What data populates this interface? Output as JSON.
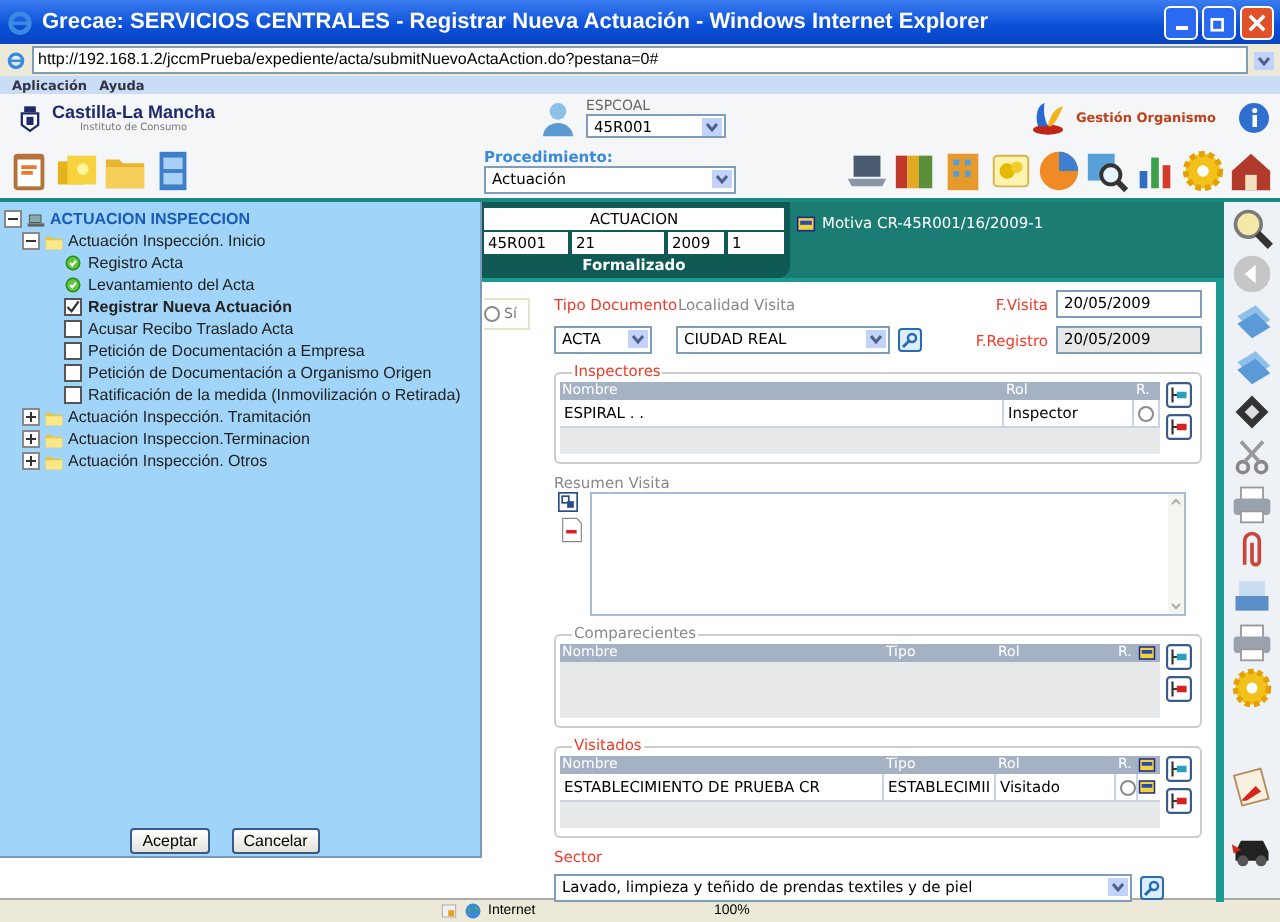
{
  "window": {
    "title": "Grecae: SERVICIOS CENTRALES - Registrar Nueva Actuación - Windows Internet Explorer"
  },
  "address_bar": {
    "url": "http://192.168.1.2/jccmPrueba/expediente/acta/submitNuevoActaAction.do?pestana=0#"
  },
  "menu": [
    "Aplicación",
    "Ayuda"
  ],
  "header": {
    "logo_title": "Castilla-La Mancha",
    "logo_subtitle": "Instituto de Consumo",
    "user": "ESPCOAL",
    "user_select": "45R001",
    "organismo": "Gestión Organismo"
  },
  "procedimiento": {
    "label": "Procedimiento:",
    "value": "Actuación"
  },
  "actuacion": {
    "title": "ACTUACION",
    "fields": [
      "45R001",
      "21",
      "2009",
      "1"
    ],
    "status": "Formalizado",
    "motiva": "Motiva CR-45R001/16/2009-1"
  },
  "si_option": {
    "label": "Sí",
    "checked": false
  },
  "form": {
    "tipo_documento": {
      "label": "Tipo Documento",
      "value": "ACTA"
    },
    "localidad": {
      "label": "Localidad Visita",
      "value": "CIUDAD REAL"
    },
    "f_visita": {
      "label": "F.Visita",
      "value": "20/05/2009"
    },
    "f_registro": {
      "label": "F.Registro",
      "value": "20/05/2009"
    },
    "inspectores": {
      "legend": "Inspectores",
      "columns": [
        "Nombre",
        "Rol",
        "R."
      ],
      "rows": [
        {
          "cells": [
            "ESPIRAL . .",
            "Inspector"
          ],
          "checked": false
        }
      ]
    },
    "resumen": {
      "label": "Resumen Visita"
    },
    "comparecientes": {
      "legend": "Comparecientes",
      "columns": [
        "Nombre",
        "Tipo",
        "Rol",
        "R."
      ]
    },
    "visitados": {
      "legend": "Visitados",
      "columns": [
        "Nombre",
        "Tipo",
        "Rol",
        "R."
      ],
      "rows": [
        {
          "cells": [
            "ESTABLECIMIENTO DE PRUEBA CR",
            "ESTABLECIMII",
            "Visitado"
          ],
          "checked": false
        }
      ]
    },
    "sector": {
      "label": "Sector",
      "value": "Lavado, limpieza y teñido de prendas textiles y de piel"
    }
  },
  "tree": {
    "label": "ACTUACION INSPECCION",
    "expanded": true,
    "children": [
      {
        "label": "Actuación Inspección. Inicio",
        "expanded": true,
        "children": [
          {
            "kind": "done",
            "label": "Registro Acta",
            "selected": false
          },
          {
            "kind": "done",
            "label": "Levantamiento del Acta",
            "selected": false
          },
          {
            "kind": "task",
            "label": "Registrar Nueva Actuación",
            "checked": true,
            "selected": true
          },
          {
            "kind": "task",
            "label": "Acusar Recibo Traslado Acta",
            "checked": false,
            "selected": false
          },
          {
            "kind": "task",
            "label": "Petición de Documentación a Empresa",
            "checked": false,
            "selected": false
          },
          {
            "kind": "task",
            "label": "Petición de Documentación a Organismo Origen",
            "checked": false,
            "selected": false
          },
          {
            "kind": "task",
            "label": "Ratificación de la medida (Inmovilización o Retirada)",
            "checked": false,
            "selected": false
          }
        ]
      },
      {
        "label": "Actuación Inspección. Tramitación",
        "expanded": false
      },
      {
        "label": "Actuacion Inspeccion.Terminacion",
        "expanded": false
      },
      {
        "label": "Actuación Inspección. Otros",
        "expanded": false
      }
    ],
    "buttons": [
      "Aceptar",
      "Cancelar"
    ]
  },
  "status_bar": {
    "zone": "Internet",
    "zoom": "100%"
  }
}
